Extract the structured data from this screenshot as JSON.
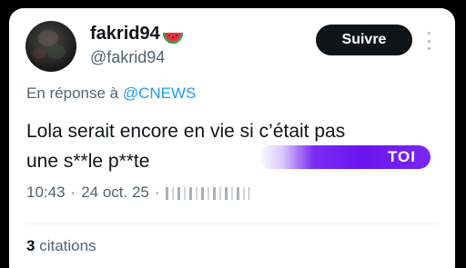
{
  "author": {
    "display_name": "fakrid94",
    "emoji_icon": "watermelon-icon",
    "handle": "@fakrid94"
  },
  "follow_button": {
    "label": "Suivre"
  },
  "more_menu_icon": "more-vertical-icon",
  "reply": {
    "prefix": "En réponse à ",
    "mention": "@CNEWS"
  },
  "tweet": {
    "lines": [
      "Lola serait encore en vie si c’était pas",
      "une s**le p**te"
    ]
  },
  "overlay_banner": {
    "text": "TOI"
  },
  "meta": {
    "time": "10:43",
    "separator": "·",
    "date": "24 oct. 25",
    "separator2": "·"
  },
  "engagement": {
    "quotes_count": "3",
    "quotes_label": "citations"
  },
  "colors": {
    "background": "#000000",
    "card": "#ffffff",
    "text_primary": "#0f1419",
    "text_secondary": "#536471",
    "link": "#1d9bf0",
    "follow_button_bg": "#0f1419",
    "banner_purple": "#6a14ee"
  }
}
